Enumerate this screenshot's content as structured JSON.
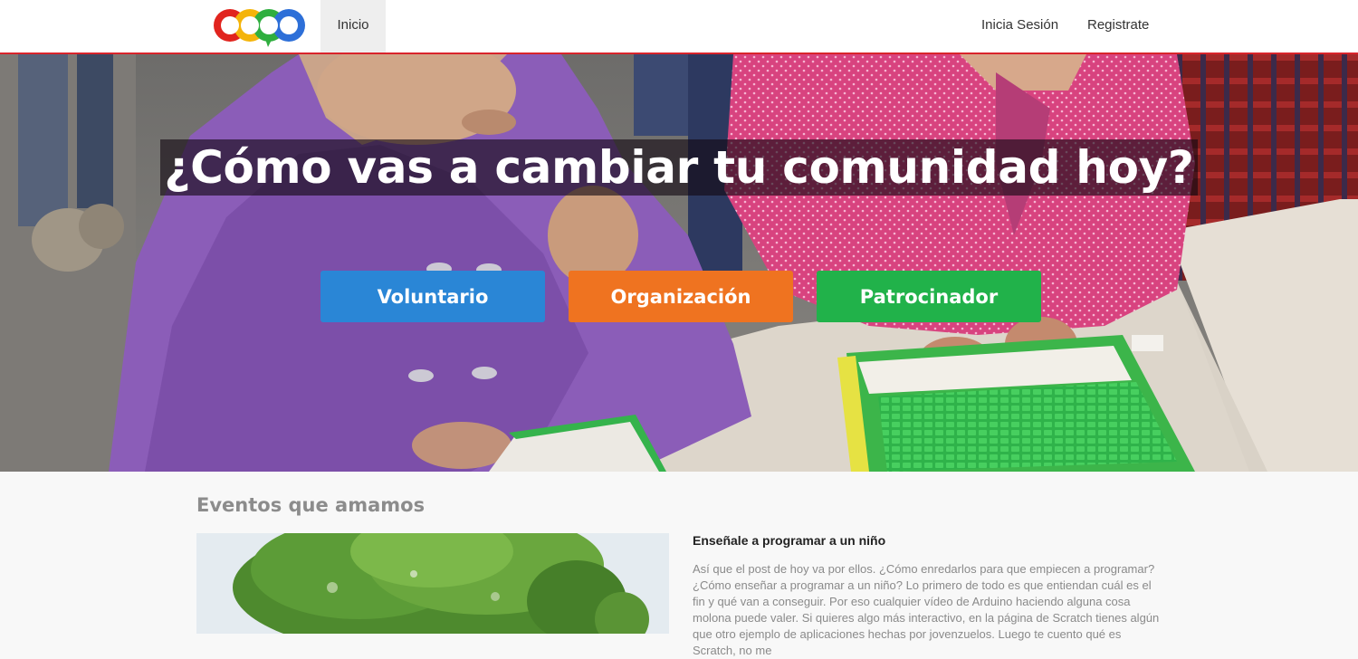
{
  "navbar": {
    "logo_name": "colorful-circles-logo",
    "links": [
      {
        "label": "Inicio",
        "active": true
      },
      {
        "label": "Inicia Sesión"
      },
      {
        "label": "Registrate"
      }
    ],
    "accent_color": "#d9242b"
  },
  "hero": {
    "title": "¿Cómo vas a cambiar tu comunidad hoy?",
    "buttons": [
      {
        "label": "Voluntario",
        "color": "#2a86d6"
      },
      {
        "label": "Organización",
        "color": "#ef7320"
      },
      {
        "label": "Patrocinador",
        "color": "#21b24a"
      }
    ]
  },
  "events": {
    "heading": "Eventos que amamos",
    "items": [
      {
        "title": "Enseñale a programar a un niño",
        "body": "Así que el post de hoy va por ellos. ¿Cómo enredarlos para que empiecen a programar? ¿Cómo enseñar a programar a un niño? Lo primero de todo es que entiendan cuál es el fin y qué van a conseguir. Por eso cualquier vídeo de Arduino haciendo alguna cosa molona puede valer. Si quieres algo más interactivo, en la página de Scratch tienes algún que otro ejemplo de aplicaciones hechas por jovenzuelos. Luego te cuento qué es Scratch, no me"
      }
    ]
  }
}
